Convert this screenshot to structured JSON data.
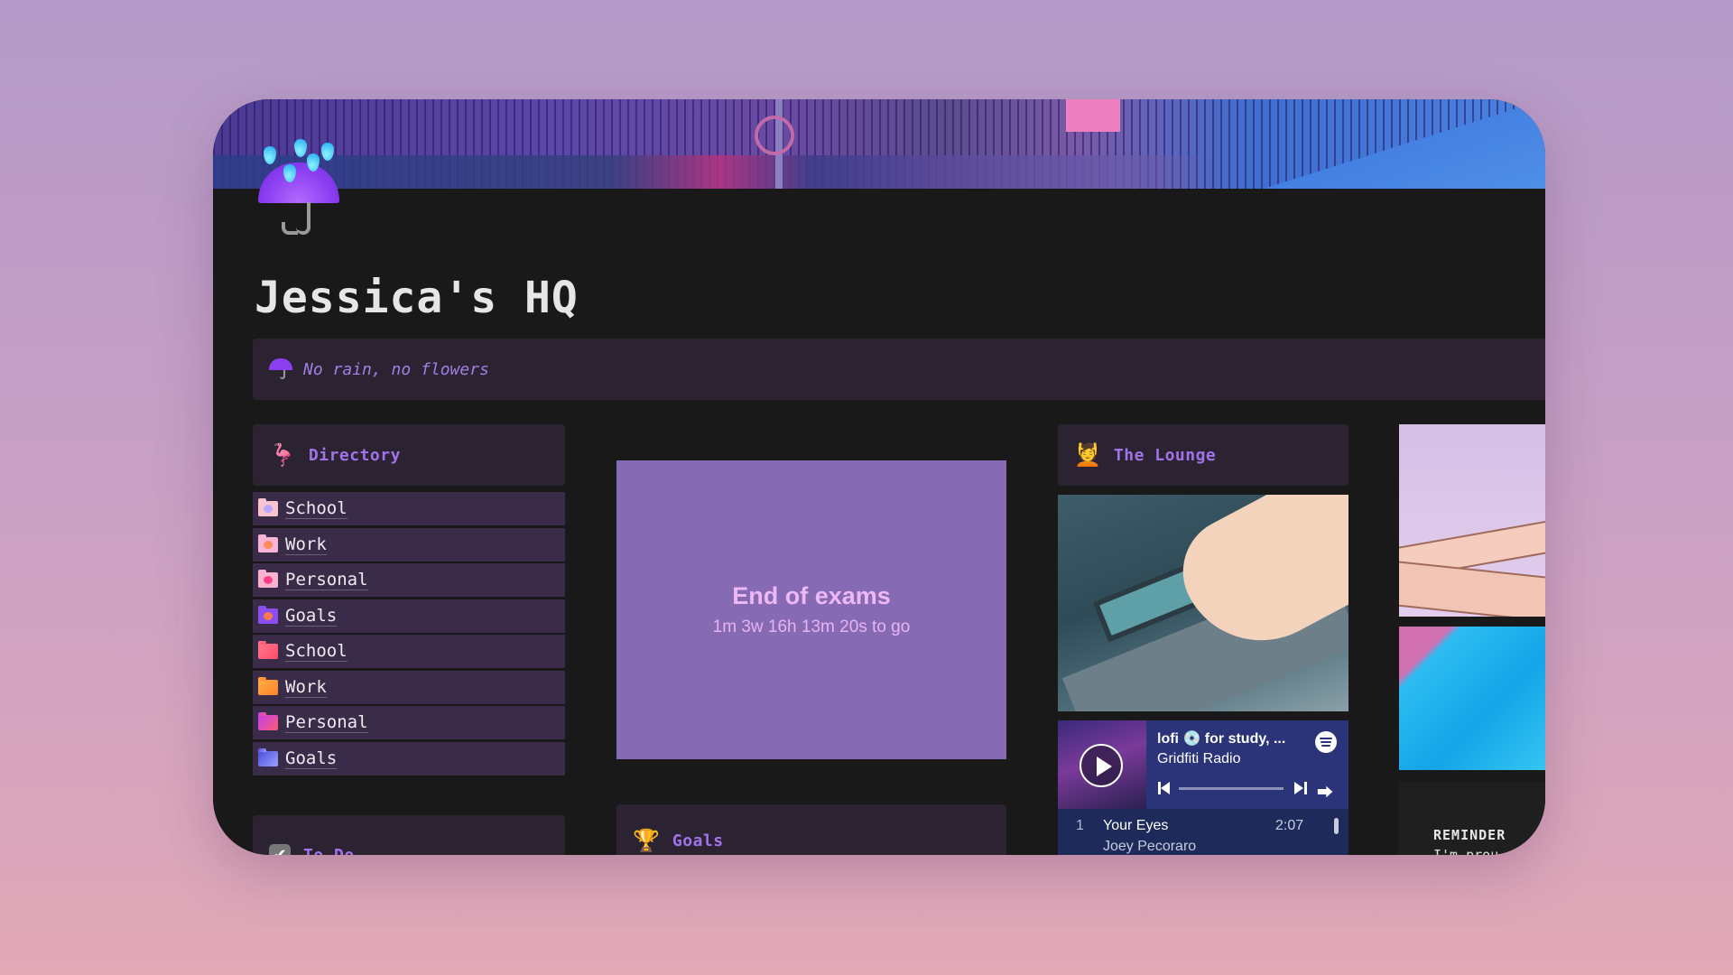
{
  "page": {
    "title": "Jessica's HQ",
    "icon": "umbrella-with-rain-icon",
    "callout": {
      "icon": "umbrella-icon",
      "text": "No rain, no flowers"
    }
  },
  "directory": {
    "icon": "flamingo-icon",
    "title": "Directory",
    "items": [
      {
        "label": "School",
        "icon": "heart-folder-icon",
        "color": "#f6c3cf",
        "accent": "#b9a6ff"
      },
      {
        "label": "Work",
        "icon": "heart-folder-icon",
        "color": "#f7b4d4",
        "accent": "#ff8a5c"
      },
      {
        "label": "Personal",
        "icon": "heart-folder-icon",
        "color": "#f7b2cf",
        "accent": "#ff3f8a"
      },
      {
        "label": "Goals",
        "icon": "heart-folder-icon",
        "color": "#8a4ef2",
        "accent": "#ff7a4a"
      },
      {
        "label": "School",
        "icon": "folder-icon",
        "color": "#ff5f7a",
        "accent": ""
      },
      {
        "label": "Work",
        "icon": "folder-icon",
        "color": "#ff9a3a",
        "accent": ""
      },
      {
        "label": "Personal",
        "icon": "folder-icon",
        "color": "#e24fc8",
        "accent": ""
      },
      {
        "label": "Goals",
        "icon": "folder-icon",
        "color": "#5a5ee0",
        "accent": ""
      }
    ]
  },
  "countdown": {
    "title": "End of exams",
    "remaining": "1m 3w 16h 13m 20s to go",
    "background": "#866ab4"
  },
  "lounge": {
    "icon": "person-getting-massage-icon",
    "title": "The Lounge",
    "player": {
      "playlist": "lofi 💿 for study, ...",
      "owner": "Gridfiti Radio",
      "play_label": "Play",
      "track": {
        "number": "1",
        "title": "Your Eyes",
        "artist": "Joey Pecoraro",
        "duration": "2:07"
      }
    }
  },
  "reminder": {
    "heading": "REMINDER",
    "text": "I'm prou"
  },
  "todo": {
    "icon": "checkbox-icon",
    "title": "To Do"
  },
  "goals": {
    "icon": "trophy-icon",
    "title": "Goals"
  },
  "colors": {
    "accent": "#a272ea",
    "panel": "#2b2332",
    "row": "#3a2c48",
    "background": "#191919"
  }
}
